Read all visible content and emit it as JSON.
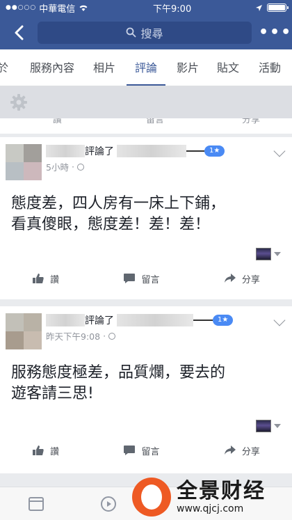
{
  "status_bar": {
    "carrier": "中華電信",
    "time": "下午9:00"
  },
  "header": {
    "search_placeholder": "搜尋"
  },
  "tabs": [
    {
      "label": "於"
    },
    {
      "label": "服務內容"
    },
    {
      "label": "相片"
    },
    {
      "label": "評論",
      "active": true
    },
    {
      "label": "影片"
    },
    {
      "label": "貼文"
    },
    {
      "label": "活動"
    }
  ],
  "partial_actions": {
    "like": "讚",
    "comment": "留言",
    "share": "分享"
  },
  "reviews": [
    {
      "verb": "評論了",
      "rating": "1★",
      "time": "5小時",
      "body_lines": [
        "態度差，四人房有一床上下鋪，",
        "看真傻眼，態度差！差！差！"
      ],
      "actions": {
        "like": "讚",
        "comment": "留言",
        "share": "分享"
      }
    },
    {
      "verb": "評論了",
      "rating": "1★",
      "time": "昨天下午9:08",
      "body_lines": [
        "服務態度極差，品質爛，要去的",
        "遊客請三思!"
      ],
      "actions": {
        "like": "讚",
        "comment": "留言",
        "share": "分享"
      }
    }
  ],
  "watermark": {
    "name": "全景财经",
    "url": "www.qjcj.com"
  },
  "colors": {
    "brand": "#3b5998",
    "rating_pill": "#4a8af4"
  }
}
